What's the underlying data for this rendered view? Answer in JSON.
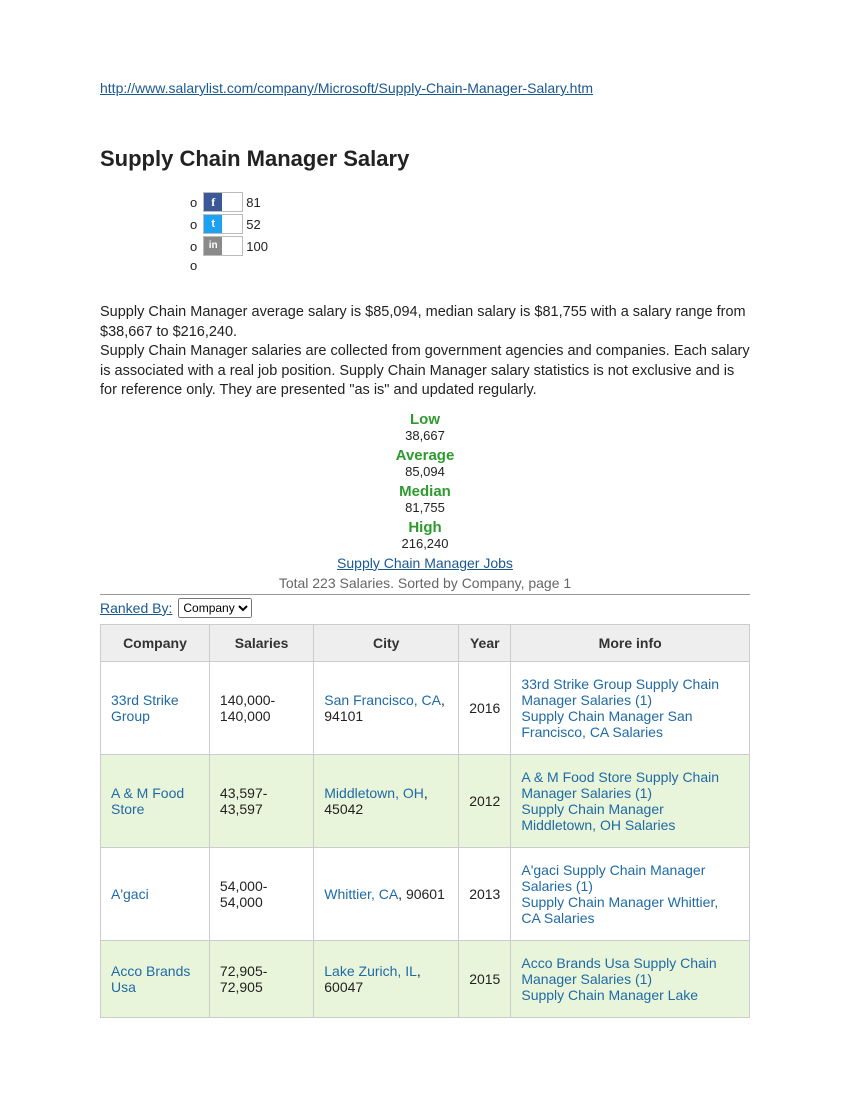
{
  "source_url": "http://www.salarylist.com/company/Microsoft/Supply-Chain-Manager-Salary.htm",
  "title": "Supply Chain Manager Salary",
  "social": [
    {
      "net": "fb",
      "glyph": "f",
      "count": "81"
    },
    {
      "net": "tw",
      "glyph": "t",
      "count": "52"
    },
    {
      "net": "li",
      "glyph": "in",
      "count": "100"
    }
  ],
  "intro1": "Supply Chain Manager average salary is $85,094, median salary is $81,755 with a salary range from $38,667 to $216,240.",
  "intro2": "Supply Chain Manager salaries are collected from government agencies and companies. Each salary is associated with a real job position. Supply Chain Manager salary statistics is not exclusive and is for reference only. They are presented \"as is\" and updated regularly.",
  "stats": {
    "low_label": "Low",
    "low": "38,667",
    "avg_label": "Average",
    "avg": "85,094",
    "med_label": "Median",
    "med": "81,755",
    "high_label": "High",
    "high": "216,240"
  },
  "jobs_link": "Supply Chain Manager Jobs",
  "summary_line": "Total 223 Salaries. Sorted by Company, page 1",
  "ranked_label": "Ranked By:",
  "ranked_value": "Company",
  "columns": [
    "Company",
    "Salaries",
    "City",
    "Year",
    "More info"
  ],
  "rows": [
    {
      "company": "33rd Strike Group",
      "salaries": "140,000-140,000",
      "city": "San Francisco, CA",
      "zip": ", 94101",
      "year": "2016",
      "more1": "33rd Strike Group Supply Chain Manager Salaries (1)",
      "more2": "Supply Chain Manager San Francisco, CA Salaries"
    },
    {
      "company": "A & M Food Store",
      "salaries": "43,597-43,597",
      "city": "Middletown, OH",
      "zip": ", 45042",
      "year": "2012",
      "more1": "A & M Food Store Supply Chain Manager Salaries (1)",
      "more2": "Supply Chain Manager Middletown, OH Salaries"
    },
    {
      "company": "A'gaci",
      "salaries": "54,000-54,000",
      "city": "Whittier, CA",
      "zip": ", 90601",
      "year": "2013",
      "more1": "A'gaci Supply Chain Manager Salaries (1)",
      "more2": "Supply Chain Manager Whittier, CA Salaries"
    },
    {
      "company": "Acco Brands Usa",
      "salaries": "72,905-72,905",
      "city": "Lake Zurich, IL",
      "zip": ", 60047",
      "year": "2015",
      "more1": "Acco Brands Usa Supply Chain Manager Salaries (1)",
      "more2": "Supply Chain Manager Lake"
    }
  ]
}
